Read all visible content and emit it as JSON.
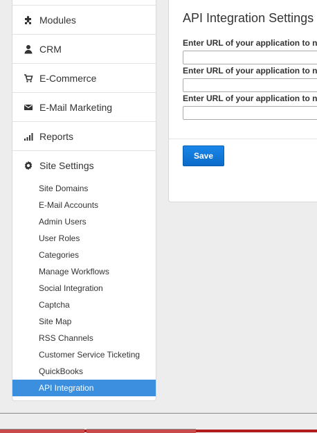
{
  "sidebar": {
    "items": [
      {
        "label": "",
        "icon": "none"
      },
      {
        "label": "Modules",
        "icon": "puzzle-icon"
      },
      {
        "label": "CRM",
        "icon": "user-icon"
      },
      {
        "label": "E-Commerce",
        "icon": "cart-icon"
      },
      {
        "label": "E-Mail Marketing",
        "icon": "envelope-icon"
      },
      {
        "label": "Reports",
        "icon": "bar-chart-icon"
      },
      {
        "label": "Site Settings",
        "icon": "gear-icon"
      }
    ],
    "sub_items": [
      {
        "label": "Site Domains"
      },
      {
        "label": "E-Mail Accounts"
      },
      {
        "label": "Admin Users"
      },
      {
        "label": "User Roles"
      },
      {
        "label": "Categories"
      },
      {
        "label": "Manage Workflows"
      },
      {
        "label": "Social Integration"
      },
      {
        "label": "Captcha"
      },
      {
        "label": "Site Map"
      },
      {
        "label": "RSS Channels"
      },
      {
        "label": "Customer Service Ticketing"
      },
      {
        "label": "QuickBooks"
      },
      {
        "label": "API Integration",
        "active": true
      }
    ]
  },
  "main": {
    "title": "API Integration Settings",
    "fields": [
      {
        "label": "Enter URL of your application to n",
        "value": ""
      },
      {
        "label": "Enter URL of your application to n",
        "value": ""
      },
      {
        "label": "Enter URL of your application to n",
        "value": ""
      }
    ],
    "save_label": "Save"
  },
  "colors": {
    "active_item": "#3c8fde",
    "save_button": "#1479d9",
    "bottom_bar": "#b11a1a"
  }
}
